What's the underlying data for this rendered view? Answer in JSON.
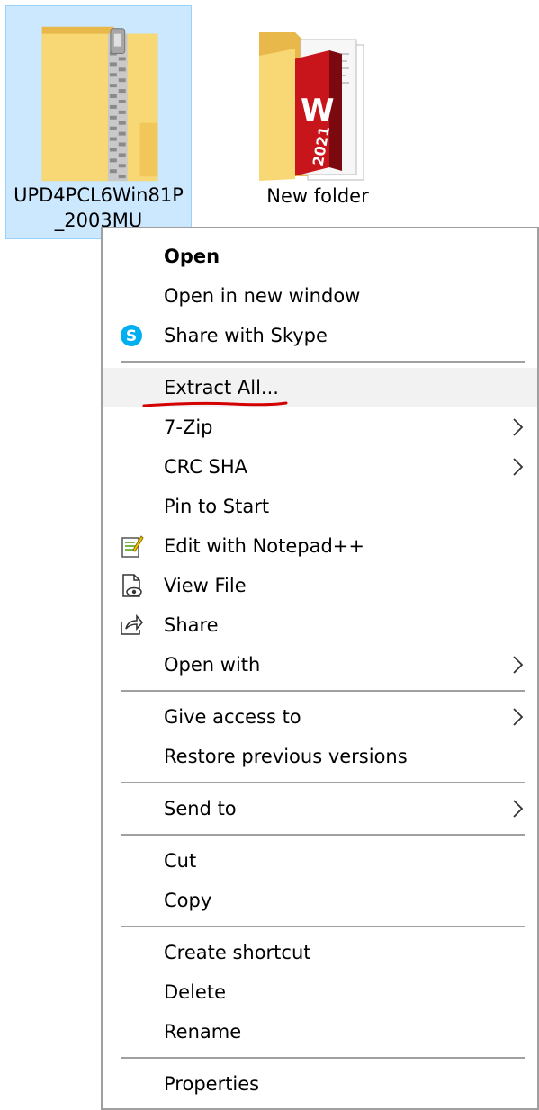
{
  "desktop": {
    "selected_file": {
      "name": "UPD4PCL6Win81P_2003MU",
      "icon": "zip-folder-icon"
    },
    "folder": {
      "name": "New folder",
      "icon": "folder-icon"
    }
  },
  "menu": {
    "open": "Open",
    "open_new_window": "Open in new window",
    "share_skype": "Share with Skype",
    "extract_all": "Extract All...",
    "seven_zip": "7-Zip",
    "crc_sha": "CRC SHA",
    "pin_to_start": "Pin to Start",
    "edit_notepad": "Edit with Notepad++",
    "view_file": "View File",
    "share": "Share",
    "open_with": "Open with",
    "give_access": "Give access to",
    "restore_versions": "Restore previous versions",
    "send_to": "Send to",
    "cut": "Cut",
    "copy": "Copy",
    "create_shortcut": "Create shortcut",
    "delete": "Delete",
    "rename": "Rename",
    "properties": "Properties"
  },
  "colors": {
    "selection_bg": "#cce8ff",
    "selection_border": "#99d1ff",
    "hover_bg": "#f2f2f2",
    "annotation_red": "#d40000",
    "skype_blue": "#00aff0"
  }
}
